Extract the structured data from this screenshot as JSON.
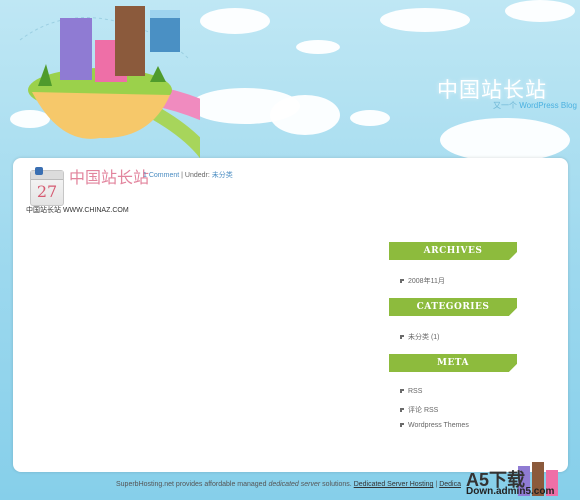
{
  "blog": {
    "title": "中国站长站",
    "tagline_prefix": "又一个",
    "tagline_suffix": "WordPress Blog"
  },
  "post": {
    "day": "27",
    "title": "中国站长站",
    "comments": "1 Comment",
    "separator": "|",
    "category_prefix": "Undedr:",
    "category": "未分类",
    "body": "中国站长站  WWW.CHINAZ.COM"
  },
  "sidebar": {
    "archives": {
      "title": "ARCHIVES",
      "items": [
        "2008年11月"
      ]
    },
    "categories": {
      "title": "CATEGORIES",
      "items": [
        "未分类 (1)"
      ]
    },
    "meta": {
      "title": "META",
      "items": [
        "RSS",
        "评论 RSS",
        "Wordpress Themes"
      ]
    }
  },
  "footer": {
    "text_a": "SuperbHosting.net provides affordable managed",
    "text_b": "dedicated server",
    "text_c": "solutions.",
    "link_1": "Dedicated Server Hosting",
    "sep": "|",
    "link_2": "Dedica"
  },
  "watermark": {
    "main": "A5下载",
    "sub": "Down.admin5.com"
  },
  "colors": {
    "sky": "#9cd8ee",
    "widget_green": "#8dbb3d",
    "title_pink": "#e2849d"
  }
}
